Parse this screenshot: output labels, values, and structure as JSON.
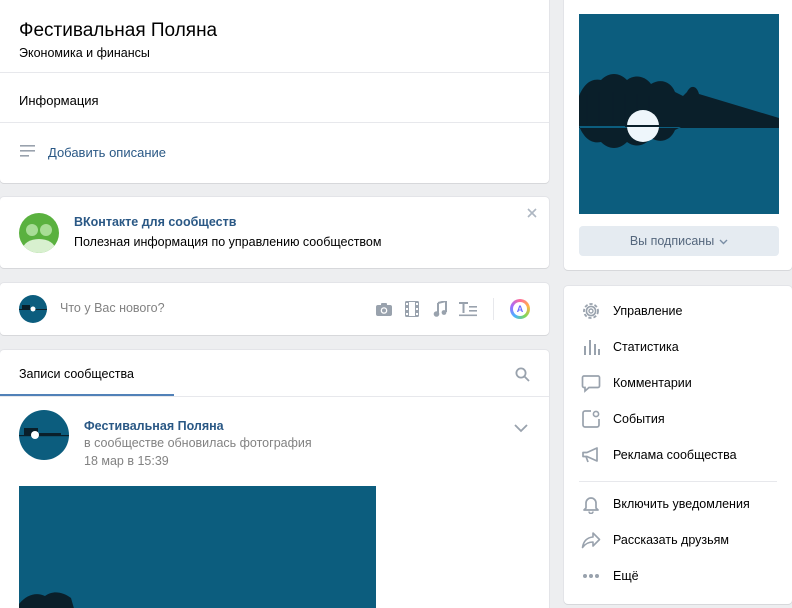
{
  "group": {
    "name": "Фестивальная Поляна",
    "category": "Экономика и финансы",
    "info_label": "Информация",
    "add_description": "Добавить описание"
  },
  "vk_for_communities": {
    "title": "ВКонтакте для сообществ",
    "text": "Полезная информация по управлению сообществом"
  },
  "composer": {
    "placeholder": "Что у Вас нового?"
  },
  "posts": {
    "tab_label": "Записи сообщества",
    "post": {
      "author": "Фестивальная Поляна",
      "action": "в сообществе обновилась фотография",
      "date": "18 мар в 15:39"
    }
  },
  "sidebar": {
    "subscribe_button": "Вы подписаны",
    "menu": [
      {
        "label": "Управление",
        "icon": "gear-icon"
      },
      {
        "label": "Статистика",
        "icon": "stats-icon"
      },
      {
        "label": "Комментарии",
        "icon": "comment-icon"
      },
      {
        "label": "События",
        "icon": "events-icon"
      },
      {
        "label": "Реклама сообщества",
        "icon": "megaphone-icon"
      }
    ],
    "menu2": [
      {
        "label": "Включить уведомления",
        "icon": "bell-icon"
      },
      {
        "label": "Рассказать друзьям",
        "icon": "share-icon"
      },
      {
        "label": "Ещё",
        "icon": "more-icon"
      }
    ]
  },
  "colors": {
    "link": "#2a5885",
    "accent": "#5181b8",
    "background": "#edeef0",
    "image_blue": "#0c5d7e"
  }
}
